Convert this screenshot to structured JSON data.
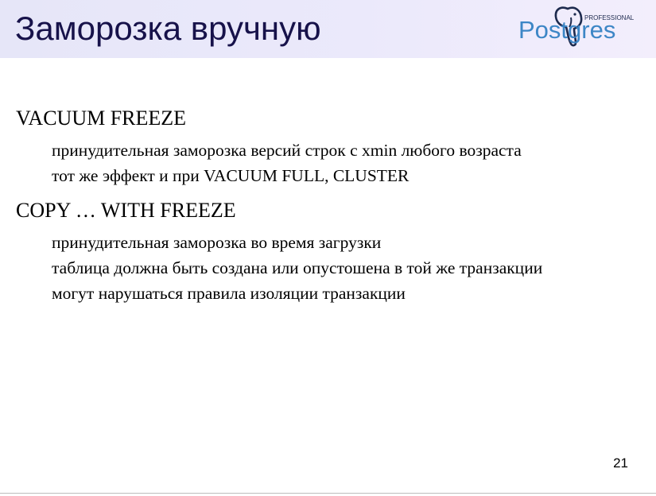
{
  "slide": {
    "title": "Заморозка вручную",
    "page_number": "21"
  },
  "logo": {
    "word": "Postgres",
    "tagline": "PROFESSIONAL",
    "color_main": "#3d86c6",
    "color_dark": "#1d2a4e"
  },
  "bullets": [
    {
      "text": "VACUUM FREEZE",
      "sub": [
        "принудительная заморозка версий строк с xmin любого возраста",
        "тот же эффект и при VACUUM FULL, CLUSTER"
      ]
    },
    {
      "text": "COPY … WITH FREEZE",
      "sub": [
        "принудительная заморозка во время загрузки",
        "таблица должна быть создана или опустошена в той же транзакции",
        "могут нарушаться правила изоляции транзакции"
      ]
    }
  ]
}
